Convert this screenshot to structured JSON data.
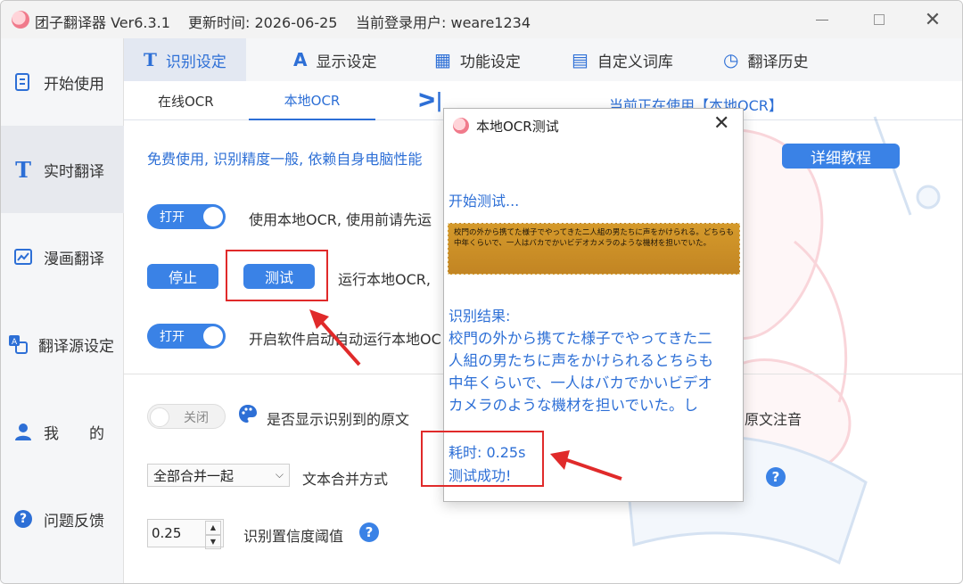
{
  "window": {
    "app_title": "团子翻译器 Ver6.3.1",
    "update_time": "更新时间: 2026-06-25",
    "login_user": "当前登录用户: weare1234",
    "close_glyph": "✕"
  },
  "sidebar": {
    "items": [
      {
        "label": "开始使用",
        "icon": "document-icon"
      },
      {
        "label": "实时翻译",
        "icon": "text-icon",
        "glyph": "T"
      },
      {
        "label": "漫画翻译",
        "icon": "image-icon"
      },
      {
        "label": "翻译源设定",
        "icon": "translate-icon"
      },
      {
        "label": "我　　的",
        "icon": "user-icon"
      },
      {
        "label": "问题反馈",
        "icon": "help-icon",
        "glyph": "?"
      }
    ]
  },
  "top_tabs": [
    {
      "label": "识别设定",
      "glyph": "T"
    },
    {
      "label": "显示设定",
      "glyph": "A"
    },
    {
      "label": "功能设定",
      "glyph": "▦"
    },
    {
      "label": "自定义词库",
      "glyph": "▤"
    },
    {
      "label": "翻译历史",
      "glyph": "◷"
    }
  ],
  "sub_tabs": {
    "online": "在线OCR",
    "local": "本地OCR",
    "collapse_glyph": "ᐳ|",
    "current_using": "当前正在使用【本地OCR】"
  },
  "main": {
    "free_desc": "免费使用, 识别精度一般, 依赖自身电脑性能",
    "tutorial_btn": "详细教程",
    "toggle_on_label": "打开",
    "toggle_off_label": "关闭",
    "use_local_ocr": "使用本地OCR, 使用前请先运",
    "stop_btn": "停止",
    "test_btn": "测试",
    "run_local_ocr": "运行本地OCR,",
    "auto_run": "开启软件启动自动运行本地OC",
    "show_original": "是否显示识别到的原文",
    "original_phonetic": "原文注音",
    "merge_select": "全部合并一起",
    "merge_label": "文本合并方式",
    "confidence_value": "0.25",
    "confidence_label": "识别置信度阈值"
  },
  "modal": {
    "title": "本地OCR测试",
    "close_glyph": "✕",
    "start_test": "开始测试...",
    "image_lines": [
      "校門の外から携てた様子でやってきた二人組の男たちに声をかけられる。どちらも",
      "中年くらいで、一人はバカでかいビデオカメラのような機材を担いでいた。"
    ],
    "result_label": "识别结果:",
    "result_lines": [
      "校門の外から携てた様子でやってきた二",
      "人組の男たちに声をかけられるとちらも",
      "中年くらいで、一人はバカでかいビデオ",
      "カメラのような機材を担いでいた。し"
    ],
    "elapsed": "耗时: 0.25s",
    "success": "测试成功!"
  },
  "colors": {
    "accent": "#2d6fd6",
    "button": "#3a82e6",
    "annotation_red": "#e02a2a"
  }
}
